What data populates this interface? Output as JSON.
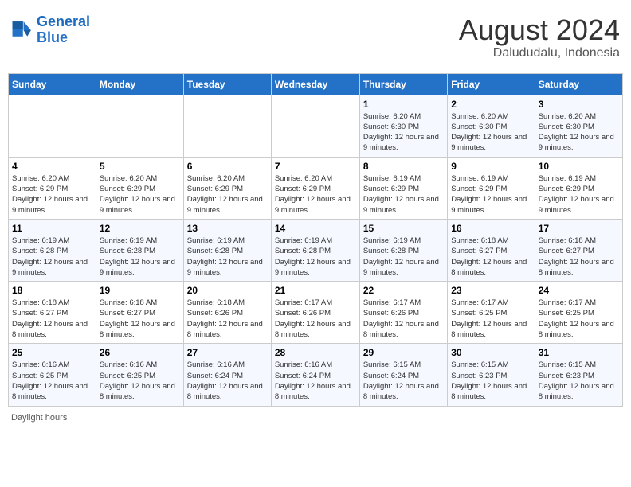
{
  "logo": {
    "line1": "General",
    "line2": "Blue"
  },
  "title": "August 2024",
  "subtitle": "Dalududalu, Indonesia",
  "days_of_week": [
    "Sunday",
    "Monday",
    "Tuesday",
    "Wednesday",
    "Thursday",
    "Friday",
    "Saturday"
  ],
  "footer": "Daylight hours",
  "weeks": [
    [
      {
        "day": "",
        "info": ""
      },
      {
        "day": "",
        "info": ""
      },
      {
        "day": "",
        "info": ""
      },
      {
        "day": "",
        "info": ""
      },
      {
        "day": "1",
        "info": "Sunrise: 6:20 AM\nSunset: 6:30 PM\nDaylight: 12 hours and 9 minutes."
      },
      {
        "day": "2",
        "info": "Sunrise: 6:20 AM\nSunset: 6:30 PM\nDaylight: 12 hours and 9 minutes."
      },
      {
        "day": "3",
        "info": "Sunrise: 6:20 AM\nSunset: 6:30 PM\nDaylight: 12 hours and 9 minutes."
      }
    ],
    [
      {
        "day": "4",
        "info": "Sunrise: 6:20 AM\nSunset: 6:29 PM\nDaylight: 12 hours and 9 minutes."
      },
      {
        "day": "5",
        "info": "Sunrise: 6:20 AM\nSunset: 6:29 PM\nDaylight: 12 hours and 9 minutes."
      },
      {
        "day": "6",
        "info": "Sunrise: 6:20 AM\nSunset: 6:29 PM\nDaylight: 12 hours and 9 minutes."
      },
      {
        "day": "7",
        "info": "Sunrise: 6:20 AM\nSunset: 6:29 PM\nDaylight: 12 hours and 9 minutes."
      },
      {
        "day": "8",
        "info": "Sunrise: 6:19 AM\nSunset: 6:29 PM\nDaylight: 12 hours and 9 minutes."
      },
      {
        "day": "9",
        "info": "Sunrise: 6:19 AM\nSunset: 6:29 PM\nDaylight: 12 hours and 9 minutes."
      },
      {
        "day": "10",
        "info": "Sunrise: 6:19 AM\nSunset: 6:29 PM\nDaylight: 12 hours and 9 minutes."
      }
    ],
    [
      {
        "day": "11",
        "info": "Sunrise: 6:19 AM\nSunset: 6:28 PM\nDaylight: 12 hours and 9 minutes."
      },
      {
        "day": "12",
        "info": "Sunrise: 6:19 AM\nSunset: 6:28 PM\nDaylight: 12 hours and 9 minutes."
      },
      {
        "day": "13",
        "info": "Sunrise: 6:19 AM\nSunset: 6:28 PM\nDaylight: 12 hours and 9 minutes."
      },
      {
        "day": "14",
        "info": "Sunrise: 6:19 AM\nSunset: 6:28 PM\nDaylight: 12 hours and 9 minutes."
      },
      {
        "day": "15",
        "info": "Sunrise: 6:19 AM\nSunset: 6:28 PM\nDaylight: 12 hours and 9 minutes."
      },
      {
        "day": "16",
        "info": "Sunrise: 6:18 AM\nSunset: 6:27 PM\nDaylight: 12 hours and 8 minutes."
      },
      {
        "day": "17",
        "info": "Sunrise: 6:18 AM\nSunset: 6:27 PM\nDaylight: 12 hours and 8 minutes."
      }
    ],
    [
      {
        "day": "18",
        "info": "Sunrise: 6:18 AM\nSunset: 6:27 PM\nDaylight: 12 hours and 8 minutes."
      },
      {
        "day": "19",
        "info": "Sunrise: 6:18 AM\nSunset: 6:27 PM\nDaylight: 12 hours and 8 minutes."
      },
      {
        "day": "20",
        "info": "Sunrise: 6:18 AM\nSunset: 6:26 PM\nDaylight: 12 hours and 8 minutes."
      },
      {
        "day": "21",
        "info": "Sunrise: 6:17 AM\nSunset: 6:26 PM\nDaylight: 12 hours and 8 minutes."
      },
      {
        "day": "22",
        "info": "Sunrise: 6:17 AM\nSunset: 6:26 PM\nDaylight: 12 hours and 8 minutes."
      },
      {
        "day": "23",
        "info": "Sunrise: 6:17 AM\nSunset: 6:25 PM\nDaylight: 12 hours and 8 minutes."
      },
      {
        "day": "24",
        "info": "Sunrise: 6:17 AM\nSunset: 6:25 PM\nDaylight: 12 hours and 8 minutes."
      }
    ],
    [
      {
        "day": "25",
        "info": "Sunrise: 6:16 AM\nSunset: 6:25 PM\nDaylight: 12 hours and 8 minutes."
      },
      {
        "day": "26",
        "info": "Sunrise: 6:16 AM\nSunset: 6:25 PM\nDaylight: 12 hours and 8 minutes."
      },
      {
        "day": "27",
        "info": "Sunrise: 6:16 AM\nSunset: 6:24 PM\nDaylight: 12 hours and 8 minutes."
      },
      {
        "day": "28",
        "info": "Sunrise: 6:16 AM\nSunset: 6:24 PM\nDaylight: 12 hours and 8 minutes."
      },
      {
        "day": "29",
        "info": "Sunrise: 6:15 AM\nSunset: 6:24 PM\nDaylight: 12 hours and 8 minutes."
      },
      {
        "day": "30",
        "info": "Sunrise: 6:15 AM\nSunset: 6:23 PM\nDaylight: 12 hours and 8 minutes."
      },
      {
        "day": "31",
        "info": "Sunrise: 6:15 AM\nSunset: 6:23 PM\nDaylight: 12 hours and 8 minutes."
      }
    ]
  ]
}
